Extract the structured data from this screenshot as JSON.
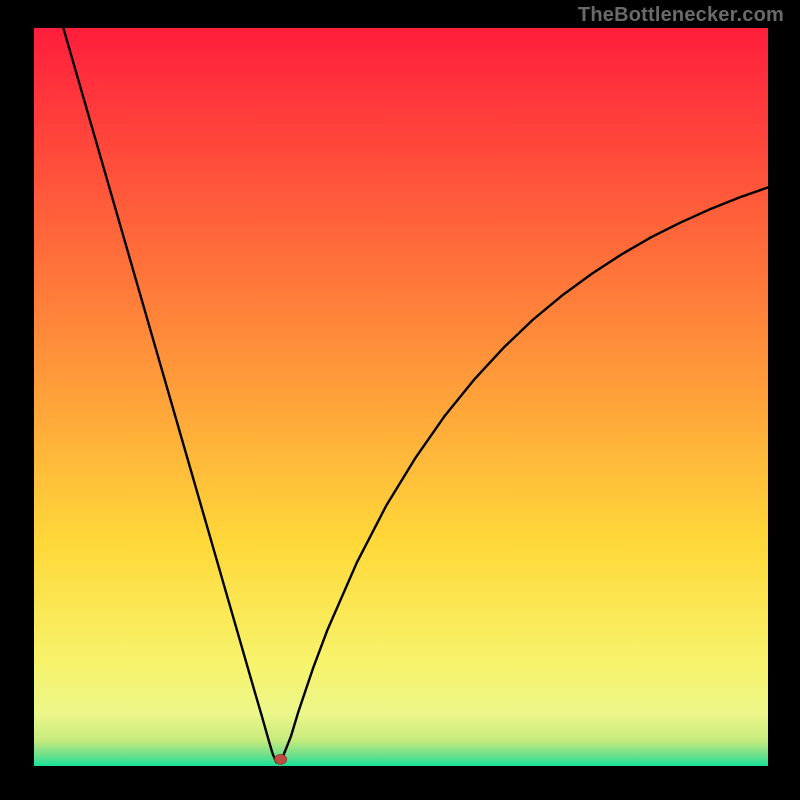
{
  "watermark": "TheBottlenecker.com",
  "chart_data": {
    "type": "line",
    "title": "",
    "xlabel": "",
    "ylabel": "",
    "xlim": [
      0,
      100
    ],
    "ylim": [
      0,
      100
    ],
    "minimum_x": 33,
    "series": [
      {
        "name": "curve",
        "x": [
          4,
          8,
          12,
          16,
          20,
          24,
          28,
          30,
          31,
          32,
          32.5,
          33,
          33.5,
          34,
          35,
          36,
          38,
          40,
          44,
          48,
          52,
          56,
          60,
          64,
          68,
          72,
          76,
          80,
          84,
          88,
          92,
          96,
          100
        ],
        "y": [
          100,
          86.2,
          72.4,
          58.6,
          44.8,
          31.0,
          17.2,
          10.3,
          6.9,
          3.4,
          1.7,
          0.5,
          0.5,
          1.5,
          4.0,
          7.3,
          13.2,
          18.5,
          27.6,
          35.3,
          41.8,
          47.5,
          52.4,
          56.7,
          60.5,
          63.8,
          66.7,
          69.3,
          71.6,
          73.6,
          75.4,
          77.0,
          78.4
        ]
      }
    ],
    "marker": {
      "x": 33.6,
      "y": 0.9
    },
    "gradient_zones": [
      {
        "pos": 0.0,
        "color": "#ff1e3c"
      },
      {
        "pos": 0.4,
        "color": "#ff863a"
      },
      {
        "pos": 0.7,
        "color": "#ffd93a"
      },
      {
        "pos": 0.86,
        "color": "#f7f36b"
      },
      {
        "pos": 0.93,
        "color": "#ecf68a"
      },
      {
        "pos": 0.965,
        "color": "#c7eb7d"
      },
      {
        "pos": 0.985,
        "color": "#6fe08b"
      },
      {
        "pos": 1.0,
        "color": "#17e39a"
      }
    ]
  }
}
